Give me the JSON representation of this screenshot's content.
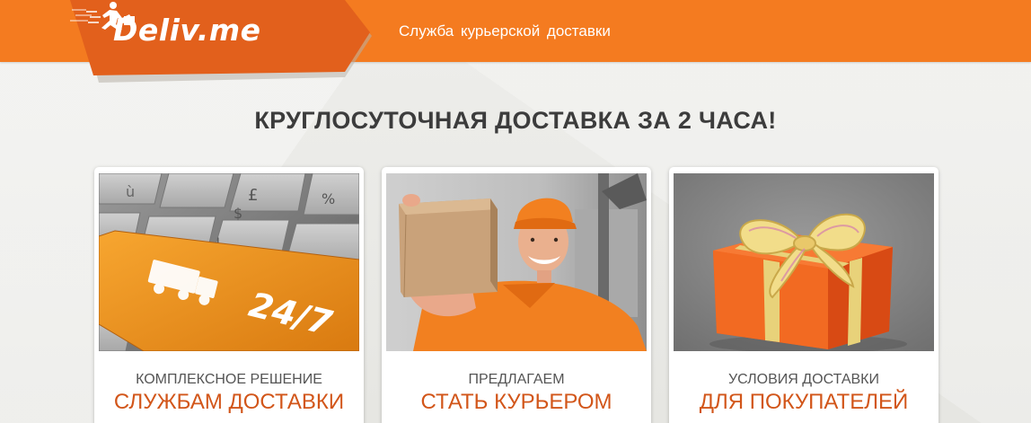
{
  "header": {
    "logo": "Deliv.me",
    "tagline": "Служба курьерской доставки"
  },
  "main": {
    "headline": "КРУГЛОСУТОЧНАЯ ДОСТАВКА ЗА 2 ЧАСА!",
    "cards": [
      {
        "line1": "КОМПЛЕКСНОЕ РЕШЕНИЕ",
        "line2": "СЛУЖБАМ ДОСТАВКИ",
        "key_label": "24/7"
      },
      {
        "line1": "ПРЕДЛАГАЕМ",
        "line2": "СТАТЬ КУРЬЕРОМ"
      },
      {
        "line1": "УСЛОВИЯ ДОСТАВКИ",
        "line2": "ДЛЯ ПОКУПАТЕЛЕЙ"
      }
    ]
  },
  "colors": {
    "brand_orange": "#f47b20",
    "logo_tab": "#e2601c",
    "accent_text": "#d2561a"
  }
}
